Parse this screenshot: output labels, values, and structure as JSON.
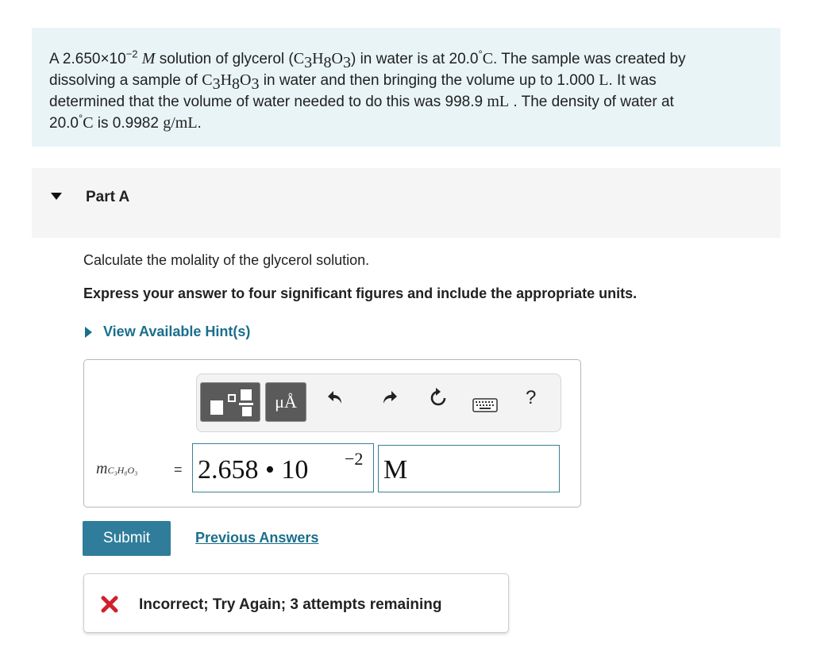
{
  "problem": {
    "p1": "A 2.650×10",
    "exp1": "−2",
    "molar": "M",
    "p2": " solution of glycerol (",
    "f_C": "C",
    "f_3": "3",
    "f_H": "H",
    "f_8": "8",
    "f_O": "O",
    "f_3b": "3",
    "p3": ") in water is at 20.0",
    "deg": "°",
    "degC": "C",
    "p4": ". The sample was created by",
    "p5": "dissolving a sample of ",
    "p6": " in water and then bringing the volume up to 1.000 ",
    "unitL": "L",
    "p7": ". It was",
    "p8": "determined that the volume of water needed to do this was 998.9 ",
    "unitmL": "mL",
    "p9": " . The density of water at",
    "p10": "20.0",
    "p11": " is 0.9982 ",
    "density_unit": "g/mL",
    "p12": "."
  },
  "part": {
    "title": "Part A"
  },
  "question": "Calculate the molality of the glycerol solution.",
  "instruction": "Express your answer to four significant figures and include the appropriate units.",
  "hint_link": "View Available Hint(s)",
  "toolbar": {
    "units_button": "μÅ",
    "help": "?",
    "icons": [
      "templates-icon",
      "units-icon",
      "undo-icon",
      "redo-icon",
      "reset-icon",
      "keyboard-icon",
      "help-icon"
    ]
  },
  "answer": {
    "variable": "m",
    "variable_sub": "C₃H₈O₃",
    "equals": "=",
    "value": "2.658 • 10",
    "exponent": "−2",
    "unit": "M"
  },
  "submit_label": "Submit",
  "previous_answers": "Previous Answers",
  "feedback": "Incorrect; Try Again; 3 attempts remaining",
  "colors": {
    "problem_bg": "#e9f4f7",
    "accent": "#2f7d9b",
    "link": "#1a6f8c",
    "error": "#d0202b"
  }
}
